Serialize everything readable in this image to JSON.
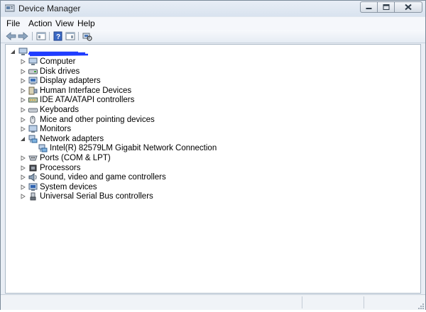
{
  "window": {
    "title": "Device Manager"
  },
  "menu": [
    "File",
    "Action",
    "View",
    "Help"
  ],
  "toolbar": {
    "buttons": [
      "back-icon",
      "forward-icon",
      "properties-pane-icon",
      "help-icon",
      "device-view-icon",
      "scan-hardware-icon"
    ]
  },
  "tree": {
    "root_label": "",
    "categories": [
      {
        "label": "Computer",
        "icon": "computer-icon",
        "expanded": false
      },
      {
        "label": "Disk drives",
        "icon": "disk-drive-icon",
        "expanded": false
      },
      {
        "label": "Display adapters",
        "icon": "display-adapter-icon",
        "expanded": false
      },
      {
        "label": "Human Interface Devices",
        "icon": "hid-icon",
        "expanded": false
      },
      {
        "label": "IDE ATA/ATAPI controllers",
        "icon": "ide-controller-icon",
        "expanded": false
      },
      {
        "label": "Keyboards",
        "icon": "keyboard-icon",
        "expanded": false
      },
      {
        "label": "Mice and other pointing devices",
        "icon": "mouse-icon",
        "expanded": false
      },
      {
        "label": "Monitors",
        "icon": "monitor-icon",
        "expanded": false
      },
      {
        "label": "Network adapters",
        "icon": "network-adapter-icon",
        "expanded": true,
        "children": [
          {
            "label": "Intel(R) 82579LM Gigabit Network Connection",
            "icon": "network-adapter-icon"
          }
        ]
      },
      {
        "label": "Ports (COM & LPT)",
        "icon": "port-icon",
        "expanded": false
      },
      {
        "label": "Processors",
        "icon": "processor-icon",
        "expanded": false
      },
      {
        "label": "Sound, video and game controllers",
        "icon": "sound-icon",
        "expanded": false
      },
      {
        "label": "System devices",
        "icon": "system-devices-icon",
        "expanded": false
      },
      {
        "label": "Universal Serial Bus controllers",
        "icon": "usb-icon",
        "expanded": false
      }
    ]
  },
  "colors": {
    "redaction": "#1f3cff",
    "accent": "#2a62c9"
  }
}
